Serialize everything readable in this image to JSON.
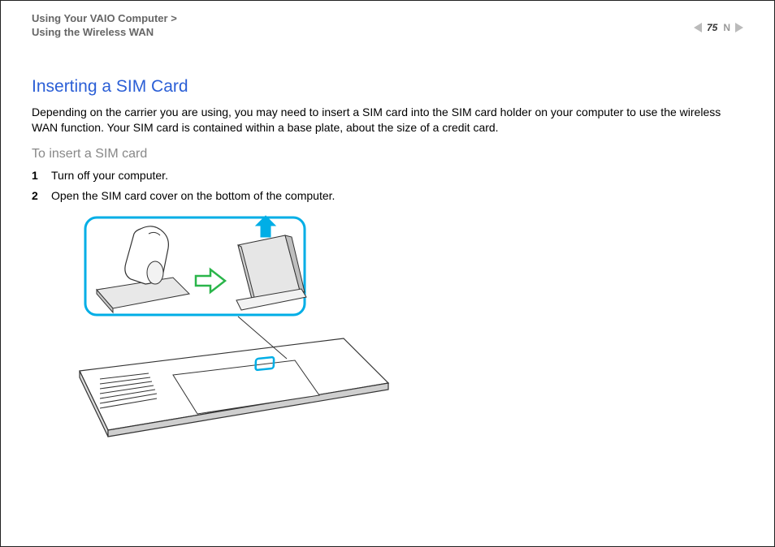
{
  "header": {
    "breadcrumb_line1": "Using Your VAIO Computer",
    "breadcrumb_sep": ">",
    "breadcrumb_line2": "Using the Wireless WAN",
    "page_number": "75",
    "next_marker": "N"
  },
  "content": {
    "heading": "Inserting a SIM Card",
    "intro": "Depending on the carrier you are using, you may need to insert a SIM card into the SIM card holder on your computer to use the wireless WAN function. Your SIM card is contained within a base plate, about the size of a credit card.",
    "subheading": "To insert a SIM card",
    "steps": [
      {
        "num": "1",
        "text": "Turn off your computer."
      },
      {
        "num": "2",
        "text": "Open the SIM card cover on the bottom of the computer."
      }
    ]
  }
}
